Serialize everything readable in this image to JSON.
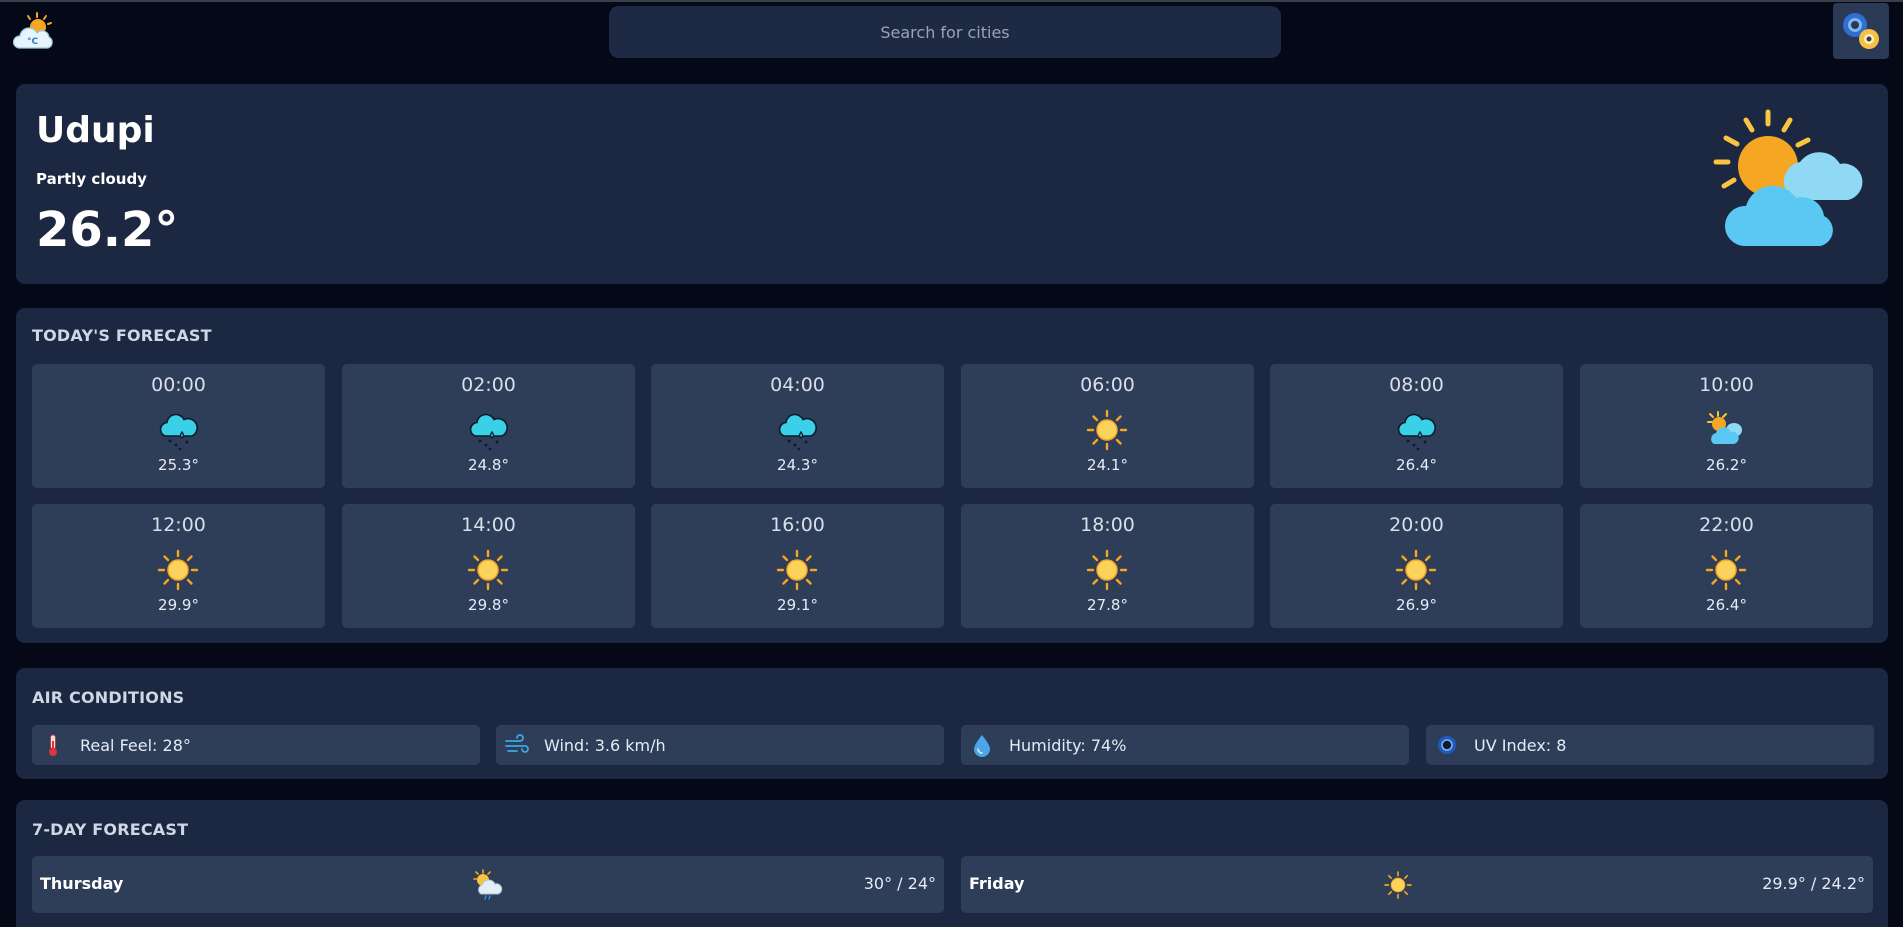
{
  "header": {
    "search_placeholder": "Search for cities",
    "logo_icon": "sun-cloud-celsius-icon",
    "settings_icon": "gears-icon"
  },
  "current": {
    "city": "Udupi",
    "condition": "Partly cloudy",
    "temperature": "26.2°",
    "icon": "partly-cloudy-icon"
  },
  "hourly": {
    "title": "TODAY'S FORECAST",
    "items": [
      {
        "time": "00:00",
        "temp": "25.3°",
        "icon": "rain-cloud-icon"
      },
      {
        "time": "02:00",
        "temp": "24.8°",
        "icon": "rain-cloud-icon"
      },
      {
        "time": "04:00",
        "temp": "24.3°",
        "icon": "rain-cloud-icon"
      },
      {
        "time": "06:00",
        "temp": "24.1°",
        "icon": "sun-icon"
      },
      {
        "time": "08:00",
        "temp": "26.4°",
        "icon": "rain-cloud-icon"
      },
      {
        "time": "10:00",
        "temp": "26.2°",
        "icon": "partly-cloudy-icon"
      },
      {
        "time": "12:00",
        "temp": "29.9°",
        "icon": "sun-icon"
      },
      {
        "time": "14:00",
        "temp": "29.8°",
        "icon": "sun-icon"
      },
      {
        "time": "16:00",
        "temp": "29.1°",
        "icon": "sun-icon"
      },
      {
        "time": "18:00",
        "temp": "27.8°",
        "icon": "sun-icon"
      },
      {
        "time": "20:00",
        "temp": "26.9°",
        "icon": "sun-icon"
      },
      {
        "time": "22:00",
        "temp": "26.4°",
        "icon": "sun-icon"
      }
    ]
  },
  "air": {
    "title": "AIR CONDITIONS",
    "real_feel": "Real Feel: 28°",
    "wind": "Wind: 3.6 km/h",
    "humidity": "Humidity: 74%",
    "uv": "UV Index: 8",
    "icons": [
      "thermometer-icon",
      "wind-icon",
      "humidity-drop-icon",
      "uv-sun-icon"
    ]
  },
  "week": {
    "title": "7-DAY FORECAST",
    "days": [
      {
        "day": "Thursday",
        "temps": "30° / 24°",
        "icon": "sun-cloud-rain-icon"
      },
      {
        "day": "Friday",
        "temps": "29.9° / 24.2°",
        "icon": "sun-icon"
      }
    ]
  },
  "colors": {
    "background": "#050816",
    "panel": "#1c2841",
    "card": "#2e3d58",
    "sun": "#f9c440",
    "cloud": "#5ac8f2"
  }
}
